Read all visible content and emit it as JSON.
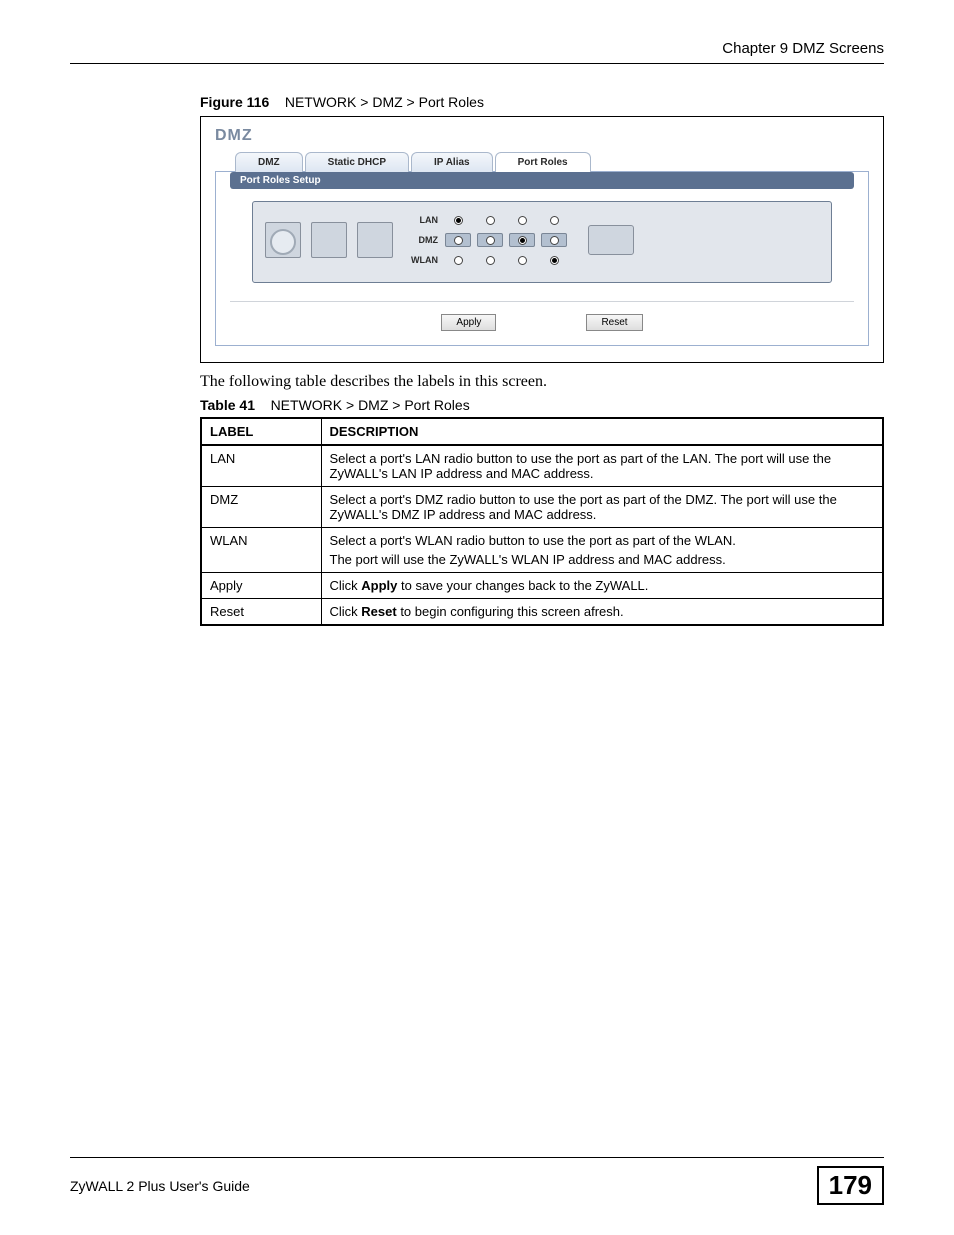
{
  "header": {
    "chapter": "Chapter 9 DMZ Screens"
  },
  "figure": {
    "label": "Figure 116",
    "title": "NETWORK > DMZ > Port Roles"
  },
  "screenshot": {
    "title": "DMZ",
    "tabs": [
      "DMZ",
      "Static DHCP",
      "IP Alias",
      "Port Roles"
    ],
    "active_tab_index": 3,
    "panel_header": "Port Roles Setup",
    "row_labels": [
      "LAN",
      "DMZ",
      "WLAN"
    ],
    "radio_state": [
      [
        true,
        false,
        false,
        false
      ],
      [
        false,
        false,
        true,
        false
      ],
      [
        false,
        false,
        false,
        true
      ]
    ],
    "buttons": {
      "apply": "Apply",
      "reset": "Reset"
    }
  },
  "paragraph": "The following table describes the labels in this screen.",
  "table_caption": {
    "label": "Table 41",
    "title": "NETWORK > DMZ > Port Roles"
  },
  "table": {
    "headers": [
      "LABEL",
      "DESCRIPTION"
    ],
    "rows": [
      {
        "label": "LAN",
        "desc_plain": "Select a port's LAN radio button to use the port as part of the LAN. The port will use the ZyWALL's LAN IP address and MAC address."
      },
      {
        "label": "DMZ",
        "desc_plain": "Select a port's DMZ radio button to use the port as part of the DMZ. The port will use the ZyWALL's DMZ IP address and MAC address."
      },
      {
        "label": "WLAN",
        "desc_plain_pre": "Select a port's WLAN radio button to use the port as part of the WLAN.",
        "desc_plain_post": "The port will use the ZyWALL's WLAN IP address and MAC address."
      },
      {
        "label": "Apply",
        "desc_pre": "Click ",
        "desc_bold": "Apply",
        "desc_post": " to save your changes back to the ZyWALL."
      },
      {
        "label": "Reset",
        "desc_pre": "Click ",
        "desc_bold": "Reset",
        "desc_post": " to begin configuring this screen afresh."
      }
    ]
  },
  "footer": {
    "guide": "ZyWALL 2 Plus User's Guide",
    "page": "179"
  }
}
